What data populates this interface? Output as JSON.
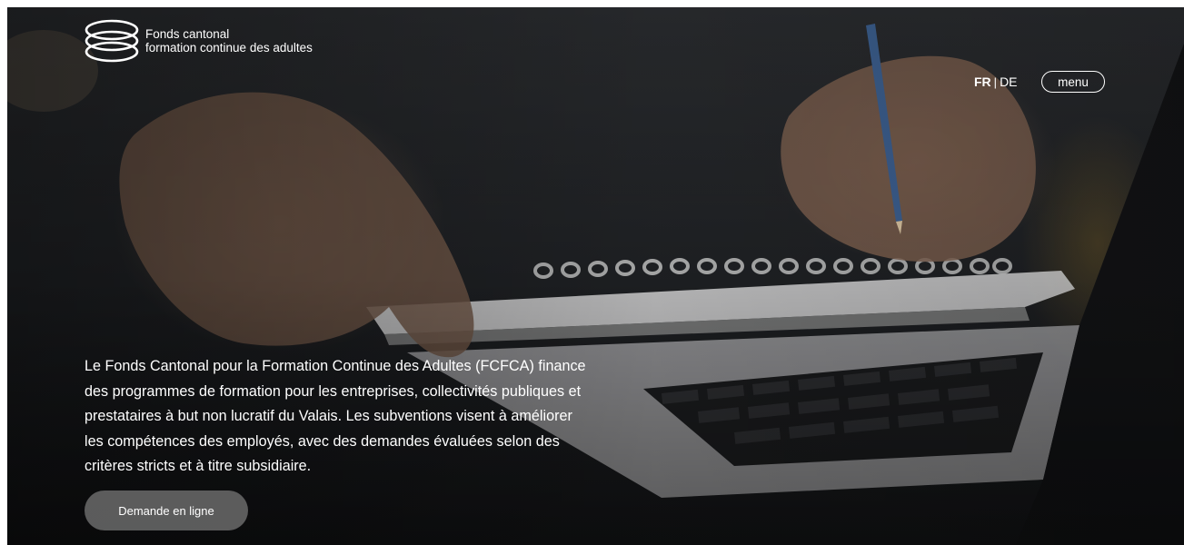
{
  "header": {
    "logo_line1": "Fonds cantonal",
    "logo_line2": "formation continue des adultes",
    "logo_icon": "stacked-rings-icon",
    "lang_active": "FR",
    "lang_separator": "|",
    "lang_other": "DE",
    "menu_label": "menu"
  },
  "hero": {
    "intro_text": "Le Fonds Cantonal pour la Formation Continue des Adultes (FCFCA) finance des programmes de formation pour les entreprises, collectivités publiques et prestataires à but non lucratif du Valais. Les subventions visent à améliorer les compétences des employés, avec des demandes évaluées selon des critères stricts et à titre subsidiaire.",
    "cta_label": "Demande en ligne"
  },
  "colors": {
    "text": "#ffffff",
    "cta_background": "#6e6e6e",
    "hero_dark": "#1d1f22"
  }
}
